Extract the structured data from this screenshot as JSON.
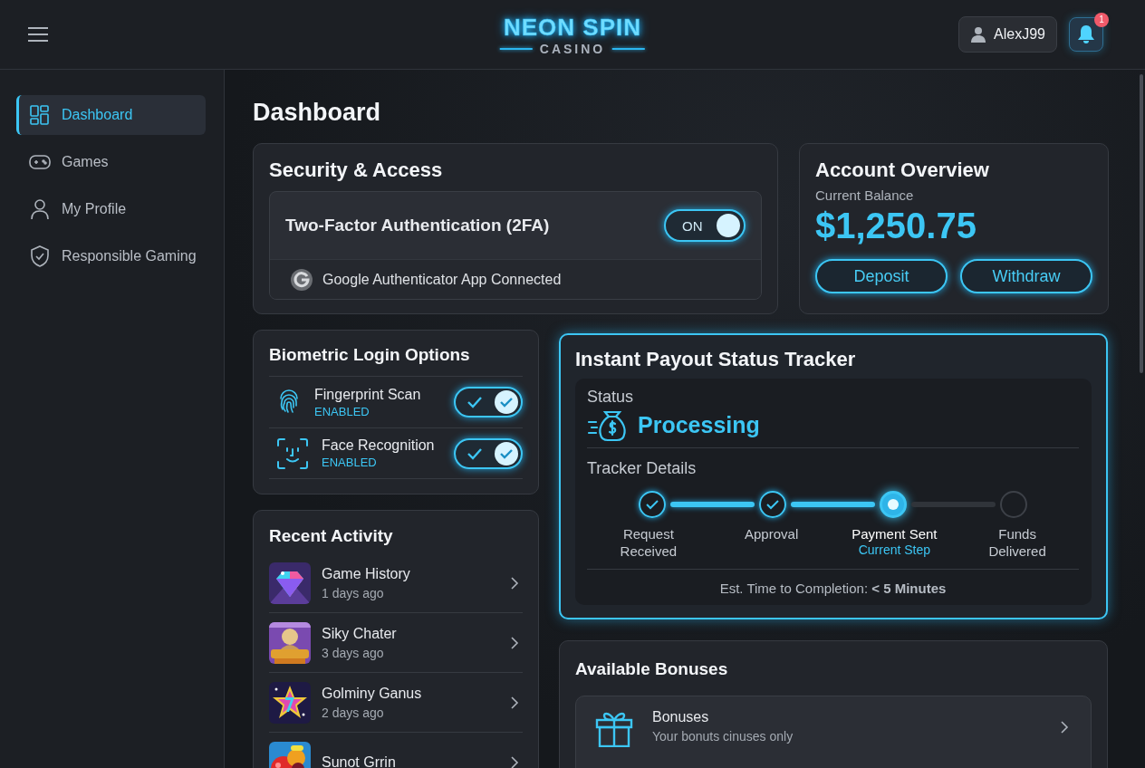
{
  "header": {
    "logo_title": "NEON SPIN",
    "logo_subtitle": "CASINO",
    "user": "AlexJ99",
    "notifications": "1"
  },
  "sidebar": {
    "items": [
      {
        "label": "Dashboard",
        "selected": true
      },
      {
        "label": "Games",
        "selected": false
      },
      {
        "label": "My Profile",
        "selected": false
      },
      {
        "label": "Responsible Gaming",
        "selected": false
      }
    ]
  },
  "page_title": "Dashboard",
  "security": {
    "title": "Security & Access",
    "two_factor": {
      "label": "Two-Factor Authentication (2FA)",
      "toggle_text": "ON",
      "on": true
    },
    "app": "Google Authenticator App Connected"
  },
  "account": {
    "title": "Account Overview",
    "balance_label": "Current Balance",
    "balance": "$1,250.75",
    "buttons": [
      "Deposit",
      "Withdraw"
    ]
  },
  "biometrics": {
    "title": "Biometric Login Options",
    "items": [
      {
        "name": "Fingerprint Scan",
        "status": "ENABLED",
        "on": true
      },
      {
        "name": "Face Recognition",
        "status": "ENABLED",
        "on": true
      }
    ]
  },
  "activity": {
    "title": "Recent Activity",
    "items": [
      {
        "title": "Game History",
        "time": "1 days ago"
      },
      {
        "title": "Siky Chater",
        "time": "3 days ago"
      },
      {
        "title": "Golminy Ganus",
        "time": "2 days ago"
      },
      {
        "title": "Sunot Grrin"
      }
    ]
  },
  "payout": {
    "title": "Instant Payout Status Tracker",
    "status_label": "Status",
    "status": "Processing",
    "details_title": "Tracker Details",
    "steps": [
      {
        "label": "Request Received",
        "done": true,
        "current": false
      },
      {
        "label": "Approval",
        "done": true,
        "current": false
      },
      {
        "label": "Payment Sent",
        "done": false,
        "current": true,
        "note": "Current Step"
      },
      {
        "label": "Funds Delivered",
        "done": false,
        "current": false
      }
    ],
    "eta": "Est. Time to Completion: **< 5 Minutes**"
  },
  "bonuses": {
    "title": "Available Bonuses",
    "items": [
      {
        "title": "Bonuses",
        "description": "Your bonuts cinuses only"
      }
    ]
  }
}
